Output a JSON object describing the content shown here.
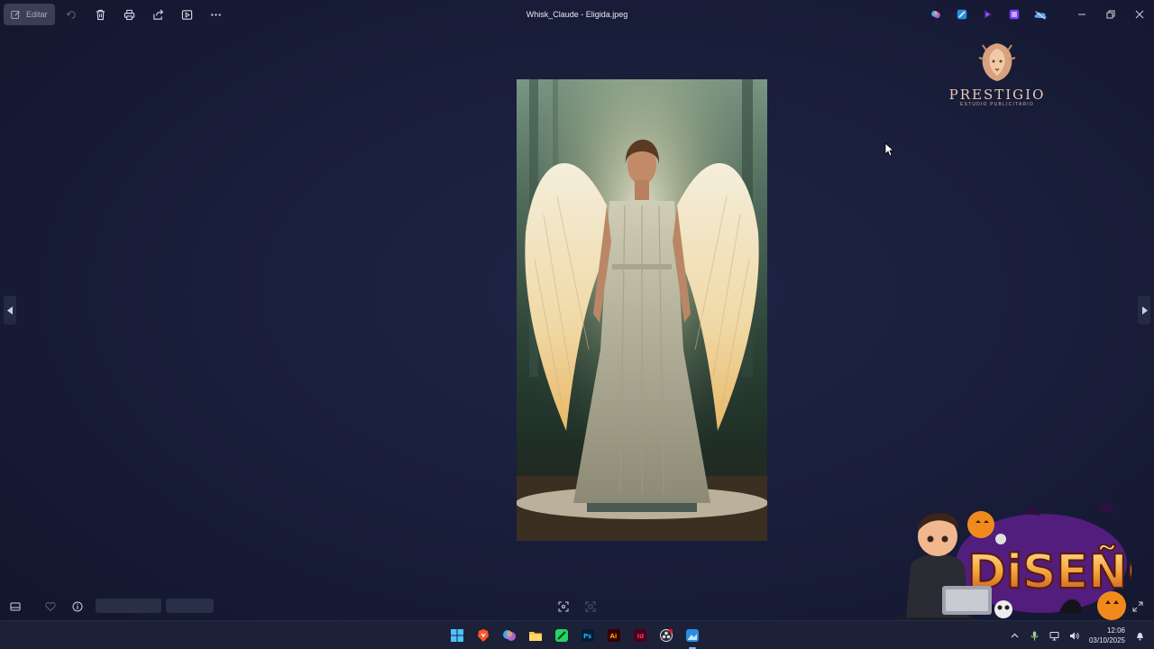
{
  "window": {
    "title": "Whisk_Claude - Eligida.jpeg",
    "edit_label": "Editar"
  },
  "toolbar": {
    "icons": [
      "edit-icon",
      "rotate-icon",
      "delete-icon",
      "print-icon",
      "share-icon",
      "slideshow-icon",
      "more-icon"
    ]
  },
  "header_apps": [
    "copilot-icon",
    "photos-editor-icon",
    "clipchamp-icon",
    "designer-icon",
    "onedrive-icon"
  ],
  "logo": {
    "name": "PRESTIGIO",
    "subtitle": "ESTUDIO PUBLICITARIO"
  },
  "sticker": {
    "text": "DiSEÑO"
  },
  "taskbar": {
    "apps": [
      "start",
      "brave",
      "copilot",
      "file-explorer",
      "whatsapp",
      "photoshop",
      "illustrator",
      "indesign",
      "obs",
      "photos"
    ],
    "time": "12:06",
    "date": "03/10/2025"
  },
  "colors": {
    "background": "#1a1f3c",
    "taskbar": "#1c2138",
    "logo": "#e8c8b2",
    "accent": "#7fb8ff"
  }
}
